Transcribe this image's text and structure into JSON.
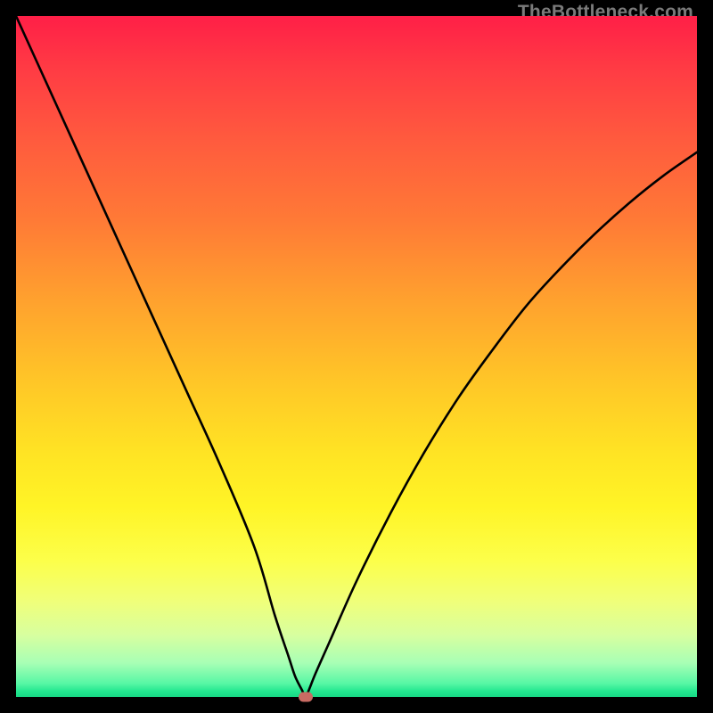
{
  "brand": "TheBottleneck.com",
  "colors": {
    "frame": "#000000",
    "gradient_top": "#ff1f47",
    "gradient_mid": "#ffe324",
    "gradient_bottom": "#17d884",
    "curve": "#000000",
    "marker": "#c96b63"
  },
  "chart_data": {
    "type": "line",
    "title": "",
    "xlabel": "",
    "ylabel": "",
    "xlim": [
      0,
      100
    ],
    "ylim": [
      0,
      100
    ],
    "series": [
      {
        "name": "bottleneck-curve",
        "x": [
          0,
          5,
          10,
          15,
          20,
          25,
          30,
          35,
          38,
          40,
          41,
          42,
          42.5,
          43,
          44,
          46,
          50,
          55,
          60,
          65,
          70,
          75,
          80,
          85,
          90,
          95,
          100
        ],
        "y": [
          100,
          89,
          78,
          67,
          56,
          45,
          34,
          22,
          12,
          6,
          3,
          1,
          0,
          1,
          3.5,
          8,
          17,
          27,
          36,
          44,
          51,
          57.5,
          63,
          68,
          72.5,
          76.5,
          80
        ]
      }
    ],
    "marker": {
      "x": 42.5,
      "y": 0
    }
  }
}
